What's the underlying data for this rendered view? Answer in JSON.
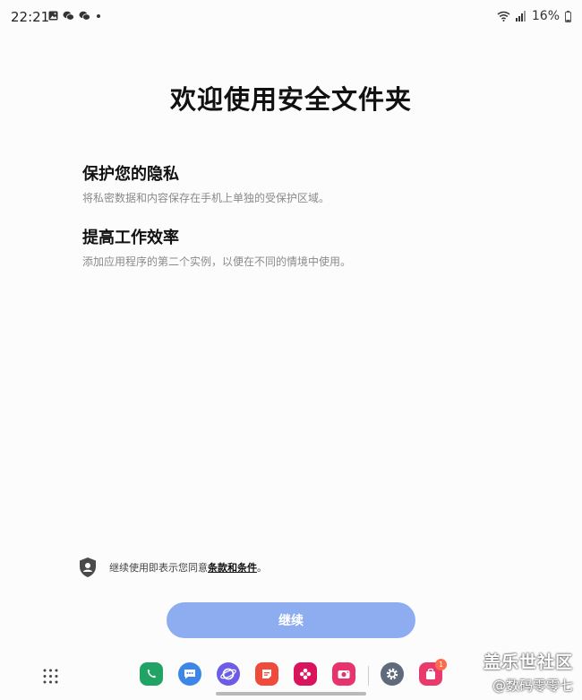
{
  "status_bar": {
    "time": "22:21",
    "left_icons": [
      "gallery-icon",
      "wechat-icon",
      "wechat-icon",
      "dot-icon"
    ],
    "battery": "16%",
    "right_icons": [
      "wifi-icon",
      "signal-icon",
      "battery-icon"
    ]
  },
  "title": "欢迎使用安全文件夹",
  "features": [
    {
      "title": "保护您的隐私",
      "description": "将私密数据和内容保存在手机上单独的受保护区域。"
    },
    {
      "title": "提高工作效率",
      "description": "添加应用程序的第二个实例，以便在不同的情境中使用。"
    }
  ],
  "terms": {
    "prefix": "继续使用即表示您同意",
    "link": "条款和条件",
    "suffix": "。"
  },
  "continue_label": "继续",
  "dock": {
    "apps": [
      {
        "name": "phone",
        "icon": "phone-icon",
        "color": "#21a366"
      },
      {
        "name": "messages",
        "icon": "messages-icon",
        "color": "#3c86e8"
      },
      {
        "name": "internet",
        "icon": "internet-icon",
        "color": "#6c5ce7"
      },
      {
        "name": "notes",
        "icon": "notes-icon",
        "color": "#f04a3b"
      },
      {
        "name": "gallery",
        "icon": "gallery-flower-icon",
        "color": "#d9145c"
      },
      {
        "name": "camera",
        "icon": "camera-icon",
        "color": "#e8326b"
      },
      {
        "name": "settings",
        "icon": "gear-icon",
        "color": "#5f6b7a"
      },
      {
        "name": "store",
        "icon": "store-bag-icon",
        "color": "#e93a6d"
      }
    ],
    "badge_count": "1"
  },
  "watermark": {
    "line1": "盖乐世社区",
    "line2": "@数码零零七"
  },
  "colors": {
    "accent": "#8eadf0",
    "background": "#fcfcfc"
  }
}
